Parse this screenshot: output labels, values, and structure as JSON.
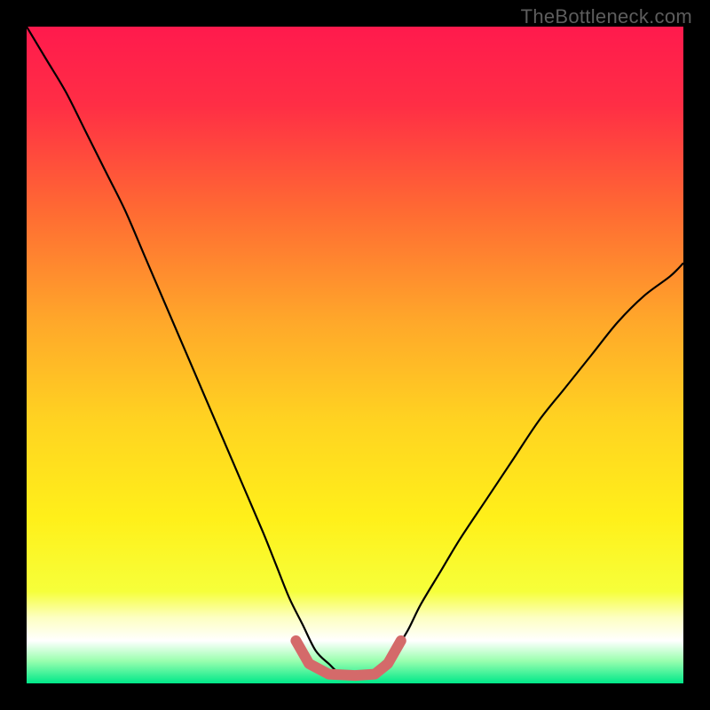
{
  "watermark": "TheBottleneck.com",
  "chart_data": {
    "type": "line",
    "title": "",
    "xlabel": "",
    "ylabel": "",
    "xlim": [
      0,
      100
    ],
    "ylim": [
      0,
      100
    ],
    "grid": false,
    "legend": false,
    "background": {
      "type": "vertical-gradient",
      "stops": [
        {
          "pos": 0.0,
          "color": "#ff1a4d"
        },
        {
          "pos": 0.12,
          "color": "#ff2e45"
        },
        {
          "pos": 0.28,
          "color": "#ff6a33"
        },
        {
          "pos": 0.45,
          "color": "#ffa82a"
        },
        {
          "pos": 0.6,
          "color": "#ffd321"
        },
        {
          "pos": 0.75,
          "color": "#fff01a"
        },
        {
          "pos": 0.86,
          "color": "#f6ff3a"
        },
        {
          "pos": 0.9,
          "color": "#fdffc2"
        },
        {
          "pos": 0.935,
          "color": "#ffffff"
        },
        {
          "pos": 0.965,
          "color": "#9cffb0"
        },
        {
          "pos": 1.0,
          "color": "#00e889"
        }
      ]
    },
    "series": [
      {
        "name": "bottleneck-curve",
        "stroke": "#000000",
        "stroke_width": 2.2,
        "x": [
          0,
          3,
          6,
          9,
          12,
          15,
          18,
          21,
          24,
          27,
          30,
          33,
          36,
          38,
          40,
          42,
          44,
          46,
          48,
          52,
          54,
          56,
          58,
          60,
          63,
          66,
          70,
          74,
          78,
          82,
          86,
          90,
          94,
          98,
          100
        ],
        "y": [
          100,
          95,
          90,
          84,
          78,
          72,
          65,
          58,
          51,
          44,
          37,
          30,
          23,
          18,
          13,
          9,
          5,
          3,
          1.5,
          1.5,
          3,
          5,
          8,
          12,
          17,
          22,
          28,
          34,
          40,
          45,
          50,
          55,
          59,
          62,
          64
        ]
      },
      {
        "name": "sweet-spot-marker",
        "stroke": "#d46a6a",
        "stroke_width": 12,
        "linecap": "round",
        "x": [
          41,
          43,
          46,
          50,
          53,
          55,
          57
        ],
        "y": [
          6.5,
          3,
          1.4,
          1.2,
          1.4,
          3,
          6.5
        ]
      }
    ]
  }
}
